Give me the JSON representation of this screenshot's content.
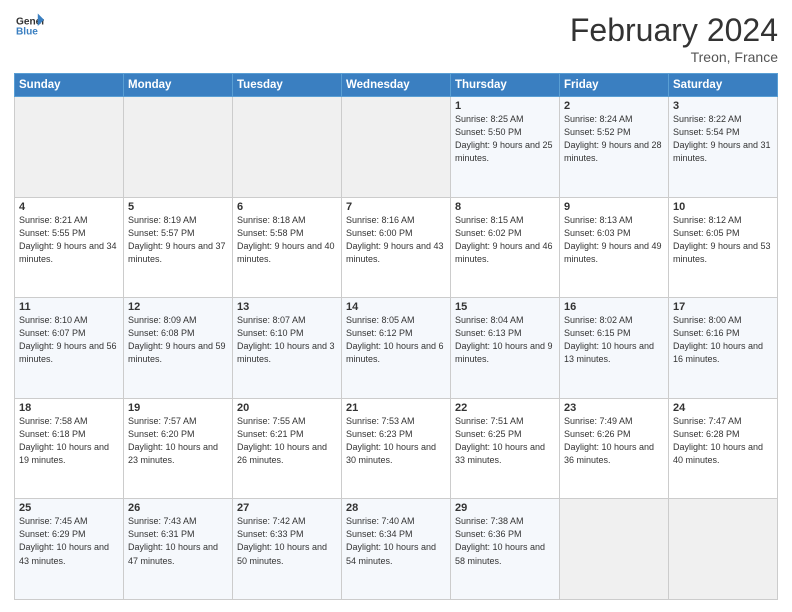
{
  "header": {
    "logo_line1": "General",
    "logo_line2": "Blue",
    "title": "February 2024",
    "subtitle": "Treon, France"
  },
  "days_of_week": [
    "Sunday",
    "Monday",
    "Tuesday",
    "Wednesday",
    "Thursday",
    "Friday",
    "Saturday"
  ],
  "weeks": [
    [
      {
        "day": "",
        "info": ""
      },
      {
        "day": "",
        "info": ""
      },
      {
        "day": "",
        "info": ""
      },
      {
        "day": "",
        "info": ""
      },
      {
        "day": "1",
        "info": "Sunrise: 8:25 AM\nSunset: 5:50 PM\nDaylight: 9 hours\nand 25 minutes."
      },
      {
        "day": "2",
        "info": "Sunrise: 8:24 AM\nSunset: 5:52 PM\nDaylight: 9 hours\nand 28 minutes."
      },
      {
        "day": "3",
        "info": "Sunrise: 8:22 AM\nSunset: 5:54 PM\nDaylight: 9 hours\nand 31 minutes."
      }
    ],
    [
      {
        "day": "4",
        "info": "Sunrise: 8:21 AM\nSunset: 5:55 PM\nDaylight: 9 hours\nand 34 minutes."
      },
      {
        "day": "5",
        "info": "Sunrise: 8:19 AM\nSunset: 5:57 PM\nDaylight: 9 hours\nand 37 minutes."
      },
      {
        "day": "6",
        "info": "Sunrise: 8:18 AM\nSunset: 5:58 PM\nDaylight: 9 hours\nand 40 minutes."
      },
      {
        "day": "7",
        "info": "Sunrise: 8:16 AM\nSunset: 6:00 PM\nDaylight: 9 hours\nand 43 minutes."
      },
      {
        "day": "8",
        "info": "Sunrise: 8:15 AM\nSunset: 6:02 PM\nDaylight: 9 hours\nand 46 minutes."
      },
      {
        "day": "9",
        "info": "Sunrise: 8:13 AM\nSunset: 6:03 PM\nDaylight: 9 hours\nand 49 minutes."
      },
      {
        "day": "10",
        "info": "Sunrise: 8:12 AM\nSunset: 6:05 PM\nDaylight: 9 hours\nand 53 minutes."
      }
    ],
    [
      {
        "day": "11",
        "info": "Sunrise: 8:10 AM\nSunset: 6:07 PM\nDaylight: 9 hours\nand 56 minutes."
      },
      {
        "day": "12",
        "info": "Sunrise: 8:09 AM\nSunset: 6:08 PM\nDaylight: 9 hours\nand 59 minutes."
      },
      {
        "day": "13",
        "info": "Sunrise: 8:07 AM\nSunset: 6:10 PM\nDaylight: 10 hours\nand 3 minutes."
      },
      {
        "day": "14",
        "info": "Sunrise: 8:05 AM\nSunset: 6:12 PM\nDaylight: 10 hours\nand 6 minutes."
      },
      {
        "day": "15",
        "info": "Sunrise: 8:04 AM\nSunset: 6:13 PM\nDaylight: 10 hours\nand 9 minutes."
      },
      {
        "day": "16",
        "info": "Sunrise: 8:02 AM\nSunset: 6:15 PM\nDaylight: 10 hours\nand 13 minutes."
      },
      {
        "day": "17",
        "info": "Sunrise: 8:00 AM\nSunset: 6:16 PM\nDaylight: 10 hours\nand 16 minutes."
      }
    ],
    [
      {
        "day": "18",
        "info": "Sunrise: 7:58 AM\nSunset: 6:18 PM\nDaylight: 10 hours\nand 19 minutes."
      },
      {
        "day": "19",
        "info": "Sunrise: 7:57 AM\nSunset: 6:20 PM\nDaylight: 10 hours\nand 23 minutes."
      },
      {
        "day": "20",
        "info": "Sunrise: 7:55 AM\nSunset: 6:21 PM\nDaylight: 10 hours\nand 26 minutes."
      },
      {
        "day": "21",
        "info": "Sunrise: 7:53 AM\nSunset: 6:23 PM\nDaylight: 10 hours\nand 30 minutes."
      },
      {
        "day": "22",
        "info": "Sunrise: 7:51 AM\nSunset: 6:25 PM\nDaylight: 10 hours\nand 33 minutes."
      },
      {
        "day": "23",
        "info": "Sunrise: 7:49 AM\nSunset: 6:26 PM\nDaylight: 10 hours\nand 36 minutes."
      },
      {
        "day": "24",
        "info": "Sunrise: 7:47 AM\nSunset: 6:28 PM\nDaylight: 10 hours\nand 40 minutes."
      }
    ],
    [
      {
        "day": "25",
        "info": "Sunrise: 7:45 AM\nSunset: 6:29 PM\nDaylight: 10 hours\nand 43 minutes."
      },
      {
        "day": "26",
        "info": "Sunrise: 7:43 AM\nSunset: 6:31 PM\nDaylight: 10 hours\nand 47 minutes."
      },
      {
        "day": "27",
        "info": "Sunrise: 7:42 AM\nSunset: 6:33 PM\nDaylight: 10 hours\nand 50 minutes."
      },
      {
        "day": "28",
        "info": "Sunrise: 7:40 AM\nSunset: 6:34 PM\nDaylight: 10 hours\nand 54 minutes."
      },
      {
        "day": "29",
        "info": "Sunrise: 7:38 AM\nSunset: 6:36 PM\nDaylight: 10 hours\nand 58 minutes."
      },
      {
        "day": "",
        "info": ""
      },
      {
        "day": "",
        "info": ""
      }
    ]
  ]
}
